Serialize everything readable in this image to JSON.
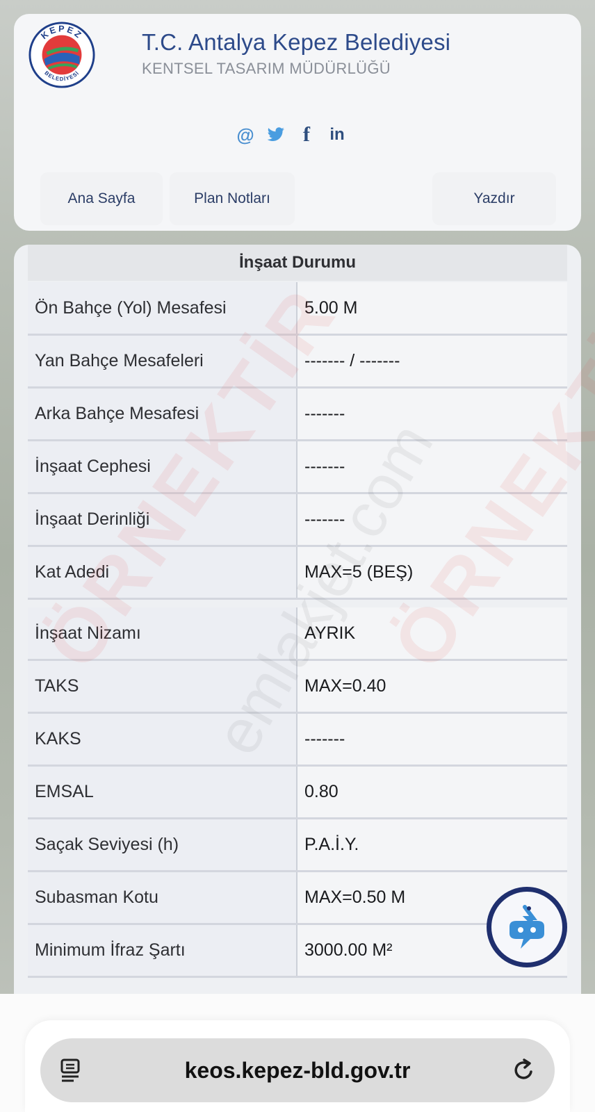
{
  "header": {
    "title": "T.C. Antalya Kepez Belediyesi",
    "subtitle": "KENTSEL TASARIM MÜDÜRLÜĞÜ",
    "logo_text_top": "KEPEZ",
    "logo_text_bottom": "BELEDİYESİ",
    "socials": [
      {
        "name": "email",
        "glyph": "@"
      },
      {
        "name": "twitter",
        "glyph": "twitter-bird"
      },
      {
        "name": "facebook",
        "glyph": "f"
      },
      {
        "name": "linkedin",
        "glyph": "in"
      }
    ],
    "nav": {
      "home": "Ana Sayfa",
      "plan_notes": "Plan Notları",
      "print": "Yazdır"
    }
  },
  "table": {
    "title": "İnşaat Durumu",
    "group1": [
      {
        "label": "Ön Bahçe (Yol) Mesafesi",
        "value": "5.00 M"
      },
      {
        "label": "Yan Bahçe Mesafeleri",
        "value": "------- / -------"
      },
      {
        "label": "Arka Bahçe Mesafesi",
        "value": "-------"
      },
      {
        "label": "İnşaat Cephesi",
        "value": "-------"
      },
      {
        "label": "İnşaat Derinliği",
        "value": "-------"
      },
      {
        "label": "Kat Adedi",
        "value": "MAX=5 (BEŞ)"
      }
    ],
    "group2": [
      {
        "label": "İnşaat Nizamı",
        "value": "AYRIK"
      },
      {
        "label": "TAKS",
        "value": "MAX=0.40"
      },
      {
        "label": "KAKS",
        "value": "-------"
      },
      {
        "label": "EMSAL",
        "value": "0.80"
      },
      {
        "label": "Saçak Seviyesi (h)",
        "value": "P.A.İ.Y."
      },
      {
        "label": "Subasman Kotu",
        "value": "MAX=0.50 M"
      },
      {
        "label": "Minimum İfraz Şartı",
        "value": "3000.00 M²"
      }
    ]
  },
  "watermark": {
    "text_red": "ÖRNEKTİR",
    "text_gray": "emlakjet.com"
  },
  "browser": {
    "url": "keos.kepez-bld.gov.tr"
  },
  "colors": {
    "title_blue": "#2d4a8a",
    "nav_text": "#2b3d66",
    "chat_ring": "#1f2f6e",
    "chat_accent": "#3a8fd6"
  }
}
